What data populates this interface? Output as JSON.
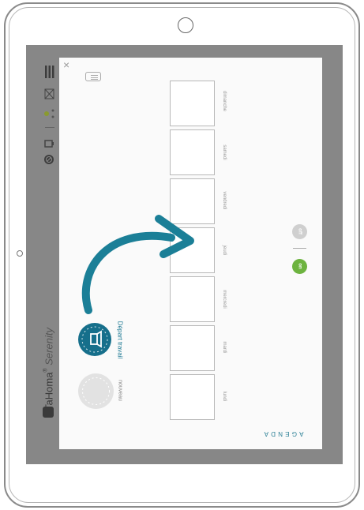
{
  "brand": {
    "name": "TaHoma",
    "sub": "Serenity",
    "reg": "®"
  },
  "modal": {
    "close": "×",
    "agenda_label": "AGENDA",
    "days": [
      "dimanche",
      "samedi",
      "vendredi",
      "jeudi",
      "mercredi",
      "mardi",
      "lundi"
    ],
    "toggle_off": "off",
    "toggle_on": "on",
    "scenario_label": "Départ travail",
    "new_label": "nouveau"
  },
  "colors": {
    "accent": "#166f8b",
    "on": "#6db33f",
    "arrow": "#1b7f97"
  },
  "icons": {
    "menu": "hamburger-icon",
    "mail": "envelope-icon",
    "close": "close-icon",
    "list": "list-icon"
  }
}
